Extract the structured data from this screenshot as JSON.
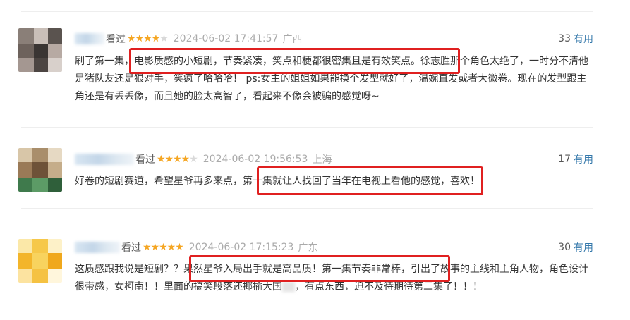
{
  "comments": [
    {
      "watched": "看过",
      "rating_stars": 4,
      "date": "2024-06-02 17:41:57",
      "location": "广西",
      "votes": "33",
      "useful_label": "有用",
      "text": "刷了第一集，电影质感的小短剧，节奏紧凑，笑点和梗都很密集且是有效笑点。徐志胜那个角色太绝了，一时分不清他是猪队友还是狠对手，笑疯了哈哈哈！ ps:女主的姐姐如果能换个发型就好了，温婉直发或者大微卷。现在的发型跟主角还是有丢丢像，而且她的脸太高智了，看起来不像会被骗的感觉呀~"
    },
    {
      "watched": "看过",
      "rating_stars": 4,
      "date": "2024-06-02 19:56:53",
      "location": "上海",
      "votes": "17",
      "useful_label": "有用",
      "text": "好卷的短剧赛道，希望星爷再多来点，第一集就让人找回了当年在电视上看他的感觉，喜欢！"
    },
    {
      "watched": "看过",
      "rating_stars": 5,
      "date": "2024-06-02 17:15:23",
      "location": "广东",
      "votes": "30",
      "useful_label": "有用",
      "text_before_blur": "这质感跟我说是短剧？？果然星爷入局出手就是高品质！第一集节奏非常棒，引出了故事的主线和主角人物，角色设计很带感，女柯南！！里面的搞笑段落还揶揄大国",
      "text_after_blur": "，有点东西，迫不及待期待第二集了！！！"
    }
  ],
  "colors": {
    "star_on": "#f5a623",
    "star_off": "#d9d9d9",
    "useful_link": "#3377aa",
    "meta_text": "#aaaaaa",
    "highlight_box": "#e02020"
  }
}
